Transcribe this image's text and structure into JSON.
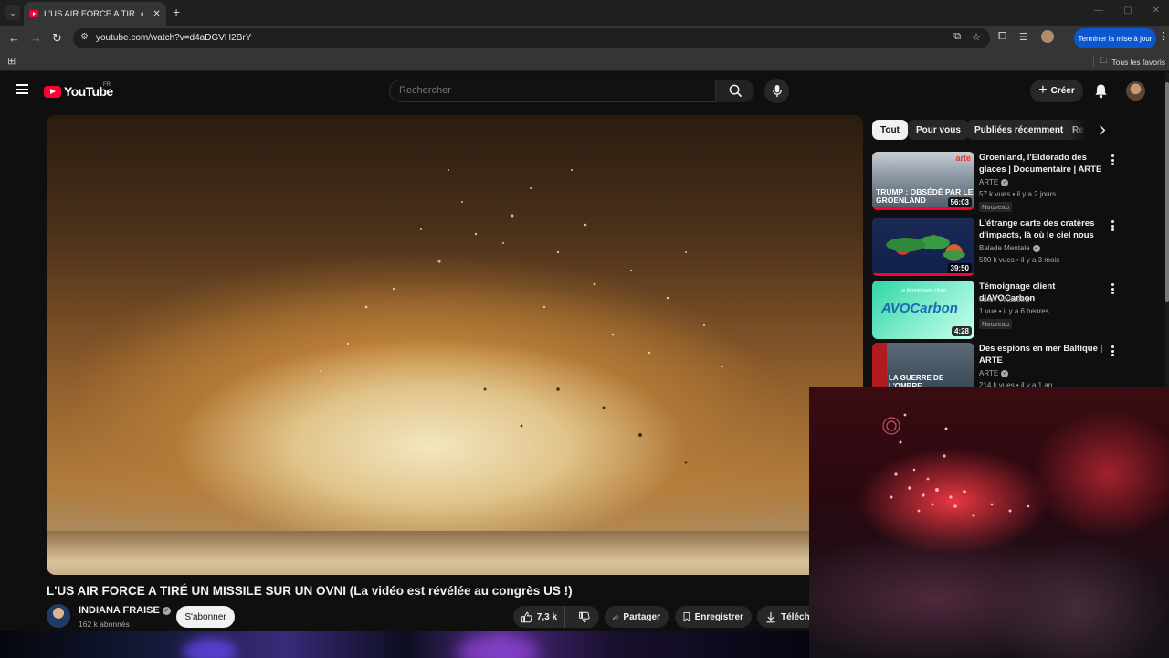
{
  "browser": {
    "tab_title": "L'US AIR FORCE A TIRÉ UN",
    "url": "youtube.com/watch?v=d4aDGVH2BrY",
    "update_button": "Terminer la mise à jour",
    "all_bookmarks": "Tous les favoris"
  },
  "youtube": {
    "country_code": "FR",
    "logo_text": "YouTube",
    "search_placeholder": "Rechercher",
    "create_label": "Créer"
  },
  "video": {
    "title": "L'US AIR FORCE A TIRÉ UN MISSILE SUR UN OVNI (La vidéo est révélée au congrès US !)",
    "channel": "INDIANA FRAISE",
    "subscribers": "162 k abonnés",
    "subscribe_label": "S'abonner",
    "likes": "7,3 k",
    "share_label": "Partager",
    "save_label": "Enregistrer",
    "download_label": "Télécha"
  },
  "chips": [
    "Tout",
    "Pour vous",
    "Publiées récemment",
    "Re"
  ],
  "recommendations": [
    {
      "title": "Groenland, l'Eldorado des glaces | Documentaire | ARTE",
      "channel": "ARTE",
      "meta": "57 k vues • il y a 2 jours",
      "badge": "Nouveau",
      "duration": "56:03",
      "thumb_text": "TRUMP : OBSÉDÉ PAR LE GROENLAND",
      "thumb_logo": "arte"
    },
    {
      "title": "L'étrange carte des cratères d'impacts, là où le ciel nous es...",
      "channel": "Balade Mentale",
      "meta": "590 k vues • il y a 3 mois",
      "duration": "39:50"
    },
    {
      "title": "Témoignage client d'AVOCarbon",
      "channel": "Innov' Akademy",
      "meta": "1 vue • il y a 6 heures",
      "badge": "Nouveau",
      "duration": "4:28",
      "thumb_small": "Le témoignage client",
      "thumb_logo": "AVOCarbon"
    },
    {
      "title": "Des espions en mer Baltique | ARTE",
      "channel": "ARTE",
      "meta": "214 k vues • il y a 1 an",
      "thumb_text": "LA GUERRE DE L'OMBRE",
      "thumb_side": "arte"
    }
  ],
  "icons": {
    "tab_audio": "speaker-icon",
    "search": "magnifier-icon",
    "mic": "microphone-icon",
    "notifications": "bell-icon",
    "like": "thumbs-up-icon",
    "dislike": "thumbs-down-icon",
    "share": "share-arrow-icon",
    "save": "bookmark-icon",
    "download": "download-icon",
    "chip_next": "chevron-right-icon"
  },
  "colors": {
    "background": "#0f0f0f",
    "brand_red": "#ff0033",
    "update_button": "#0b57d0",
    "pill": "#272727",
    "text": "#f1f1f1",
    "muted": "#aaaaaa"
  }
}
